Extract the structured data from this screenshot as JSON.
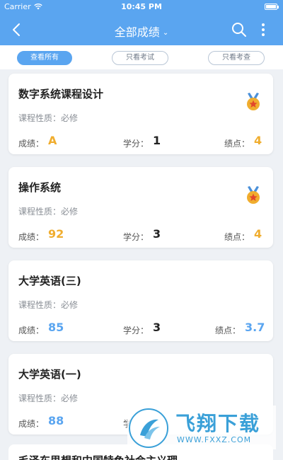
{
  "status": {
    "carrier": "Carrier",
    "time": "10:45 PM"
  },
  "nav": {
    "title": "全部成绩"
  },
  "filters": [
    {
      "label": "查看所有",
      "active": true
    },
    {
      "label": "只看考试",
      "active": false
    },
    {
      "label": "只看考查",
      "active": false
    }
  ],
  "labels": {
    "type": "课程性质：",
    "score": "成绩：",
    "credit": "学分：",
    "gpa": "绩点："
  },
  "courses": [
    {
      "name": "数字系统课程设计",
      "type": "必修",
      "score": "A",
      "credit": "1",
      "gpa": "4",
      "medal": true,
      "score_color": "#f0ad2e"
    },
    {
      "name": "操作系统",
      "type": "必修",
      "score": "92",
      "credit": "3",
      "gpa": "4",
      "medal": true,
      "score_color": "#f0ad2e"
    },
    {
      "name": "大学英语(三)",
      "type": "必修",
      "score": "85",
      "credit": "3",
      "gpa": "3.7",
      "medal": false,
      "score_color": "#5aa5f0"
    },
    {
      "name": "大学英语(一)",
      "type": "必修",
      "score": "88",
      "credit": "",
      "gpa": "",
      "medal": false,
      "score_color": "#5aa5f0"
    }
  ],
  "partial_course": {
    "name": "毛泽东思想和中国特色社会主义理"
  },
  "watermark": {
    "brand": "飞翔下载",
    "url": "WWW.FXXZ.COM"
  },
  "colors": {
    "primary": "#5aa5f0",
    "gold": "#f0ad2e",
    "blue_value": "#5aa5f0"
  },
  "icons": [
    "back-icon",
    "chevron-down-icon",
    "search-icon",
    "more-icon",
    "medal-icon",
    "wifi-icon",
    "battery-icon"
  ]
}
